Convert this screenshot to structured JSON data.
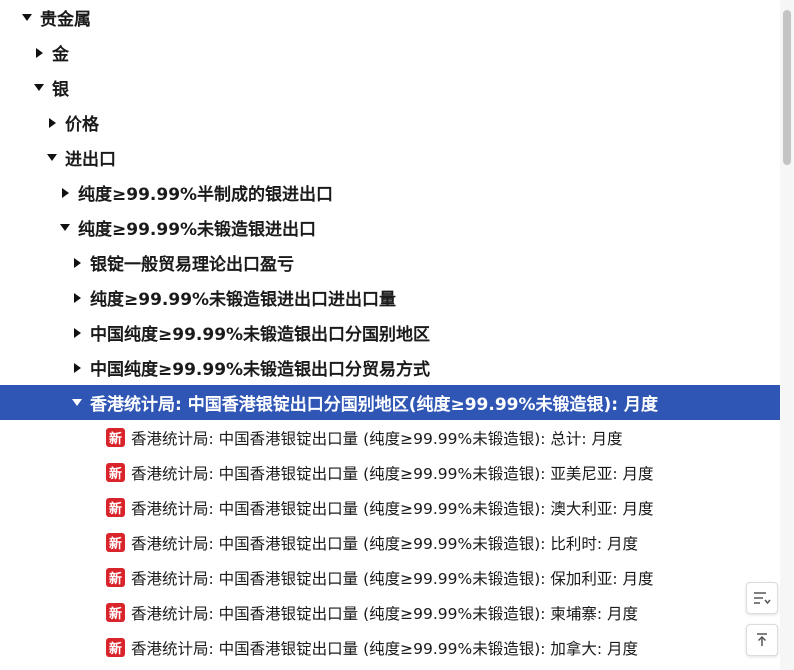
{
  "tree": {
    "root": "贵金属",
    "gold": "金",
    "silver": "银",
    "price": "价格",
    "import_export": "进出口",
    "semi_finished": "纯度≥99.99%半制成的银进出口",
    "unwrought": "纯度≥99.99%未锻造银进出口",
    "ingot_profit": "银锭一般贸易理论出口盈亏",
    "unwrought_volume": "纯度≥99.99%未锻造银进出口进出口量",
    "china_by_country": "中国纯度≥99.99%未锻造银出口分国别地区",
    "china_by_trade": "中国纯度≥99.99%未锻造银出口分贸易方式",
    "hk_stats": "香港统计局: 中国香港银锭出口分国别地区(纯度≥99.99%未锻造银): 月度"
  },
  "leaves": {
    "badge": "新",
    "items": [
      "香港统计局: 中国香港银锭出口量 (纯度≥99.99%未锻造银): 总计: 月度",
      "香港统计局: 中国香港银锭出口量 (纯度≥99.99%未锻造银): 亚美尼亚: 月度",
      "香港统计局: 中国香港银锭出口量 (纯度≥99.99%未锻造银): 澳大利亚: 月度",
      "香港统计局: 中国香港银锭出口量 (纯度≥99.99%未锻造银): 比利时: 月度",
      "香港统计局: 中国香港银锭出口量 (纯度≥99.99%未锻造银): 保加利亚: 月度",
      "香港统计局: 中国香港银锭出口量 (纯度≥99.99%未锻造银): 柬埔寨: 月度",
      "香港统计局: 中国香港银锭出口量 (纯度≥99.99%未锻造银): 加拿大: 月度"
    ]
  },
  "icons": {
    "expanded": "triangle-down-icon",
    "collapsed": "triangle-right-icon",
    "sort": "sort-lines-icon",
    "back_to_top": "arrow-up-to-top-icon"
  },
  "colors": {
    "selected_bg": "#2f56b4",
    "badge_bg": "#d9242b"
  }
}
